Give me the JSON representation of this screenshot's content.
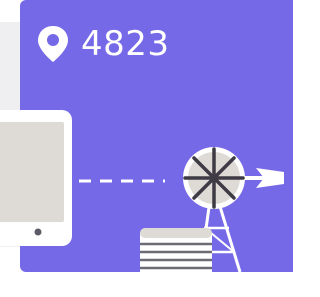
{
  "location": {
    "code": "4823",
    "icon": "map-pin-icon"
  },
  "colors": {
    "card_background": "#7669e8",
    "band_background": "#efeef0",
    "device_fill": "#dedbd6",
    "accent_white": "#ffffff"
  },
  "illustration": {
    "device": "phone-icon",
    "link": "dashed-connection-line",
    "windmill": "windmill-icon",
    "tank": "water-tank-icon"
  }
}
